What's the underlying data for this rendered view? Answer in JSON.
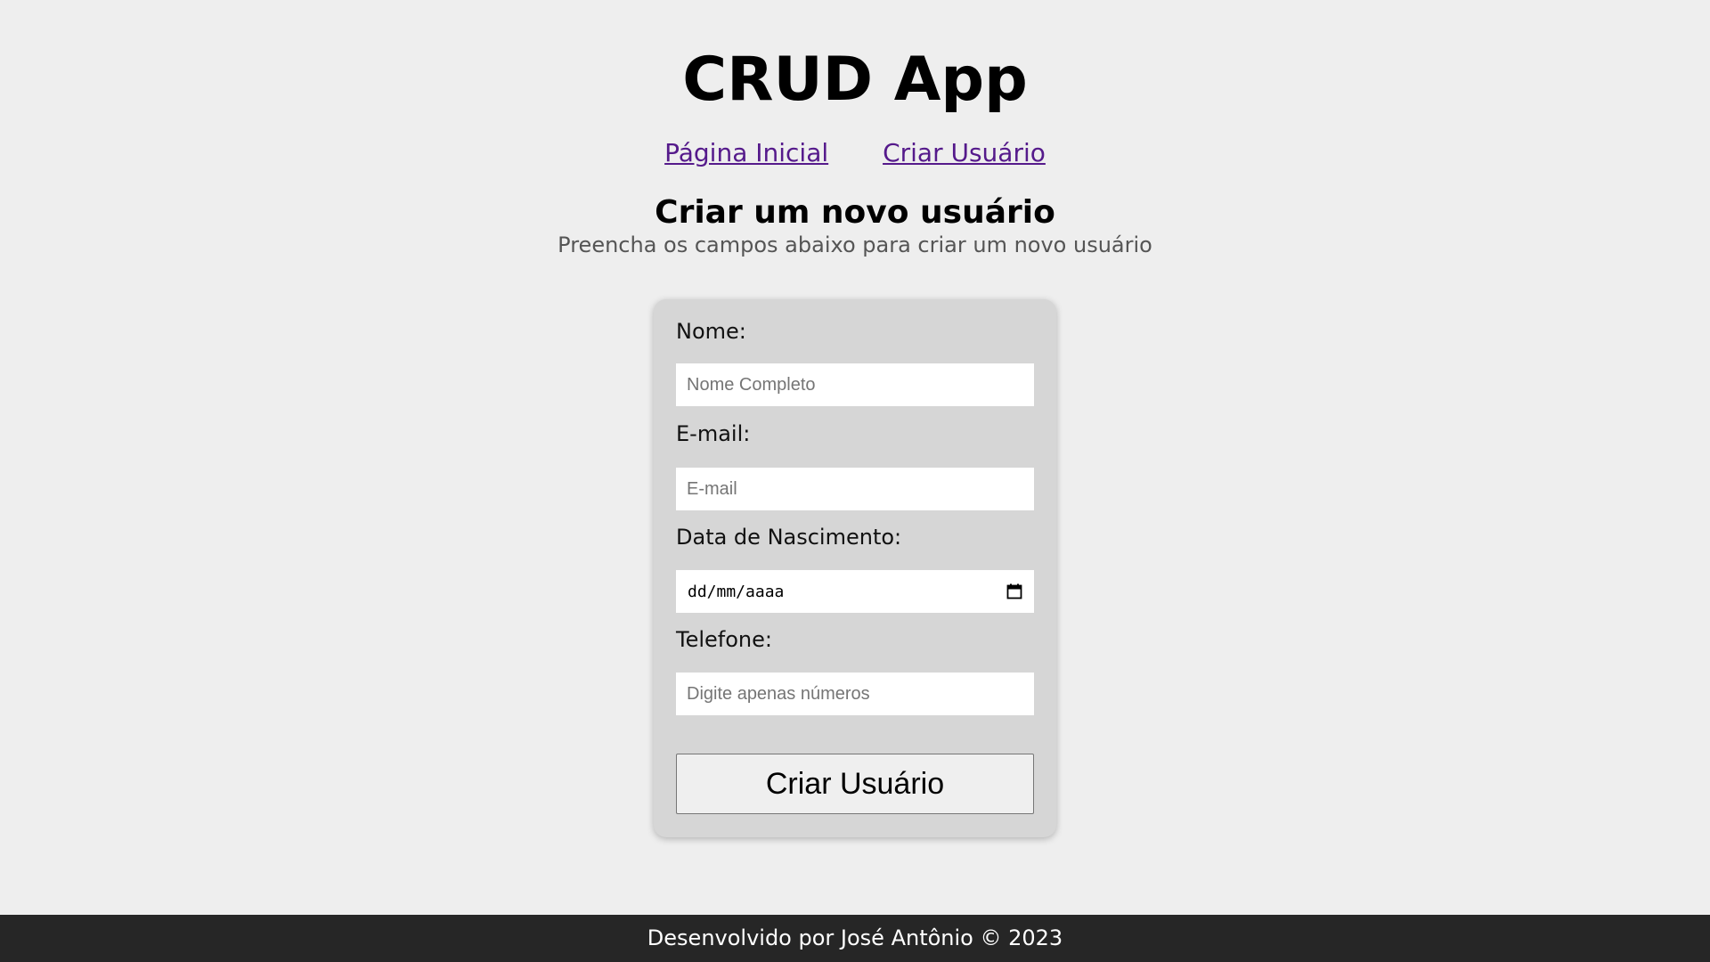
{
  "header": {
    "title": "CRUD App"
  },
  "nav": {
    "items": [
      {
        "label": "Página Inicial"
      },
      {
        "label": "Criar Usuário"
      }
    ]
  },
  "main": {
    "title": "Criar um novo usuário",
    "subtitle": "Preencha os campos abaixo para criar um novo usuário"
  },
  "form": {
    "fields": {
      "name": {
        "label": "Nome:",
        "placeholder": "Nome Completo",
        "value": ""
      },
      "email": {
        "label": "E-mail:",
        "placeholder": "E-mail",
        "value": ""
      },
      "birthdate": {
        "label": "Data de Nascimento:",
        "placeholder": "dd/mm/aaaa",
        "value": "",
        "icon": "calendar-icon"
      },
      "phone": {
        "label": "Telefone:",
        "placeholder": "Digite apenas números",
        "value": ""
      }
    },
    "submit_label": "Criar Usuário"
  },
  "footer": {
    "text": "Desenvolvido por José Antônio © 2023"
  },
  "colors": {
    "background": "#eeeeee",
    "card": "#d6d6d6",
    "link": "#551a8b",
    "footer": "#262626"
  }
}
